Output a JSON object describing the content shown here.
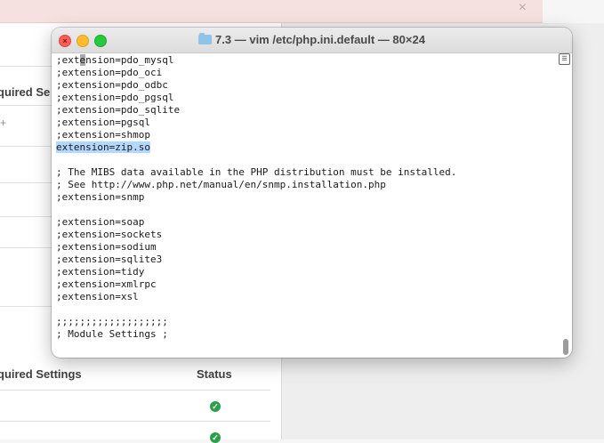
{
  "window": {
    "title": "7.3 — vim /etc/php.ini.default — 80×24"
  },
  "editor": {
    "lines": [
      ";extension=pdo_mysql",
      ";extension=pdo_oci",
      ";extension=pdo_odbc",
      ";extension=pdo_pgsql",
      ";extension=pdo_sqlite",
      ";extension=pgsql",
      ";extension=shmop",
      "extension=zip.so",
      "",
      "; The MIBS data available in the PHP distribution must be installed.",
      "; See http://www.php.net/manual/en/snmp.installation.php",
      ";extension=snmp",
      "",
      ";extension=soap",
      ";extension=sockets",
      ";extension=sodium",
      ";extension=sqlite3",
      ";extension=tidy",
      ";extension=xmlrpc",
      ";extension=xsl",
      "",
      ";;;;;;;;;;;;;;;;;;;",
      "; Module Settings ;"
    ],
    "cursor_line": 0,
    "cursor_col": 4,
    "selected_line": 7
  },
  "background": {
    "alert_close": "×",
    "header_1": "quired Se",
    "header_2": "quired Settings",
    "status_header": "Status",
    "plus_sign": "+",
    "check_glyph": "✓"
  },
  "colors": {
    "selection": "#b3d7ff",
    "close_light": "#ff5f57",
    "min_light": "#febc2e",
    "max_light": "#28c840",
    "status_ok": "#2c9f4b"
  }
}
